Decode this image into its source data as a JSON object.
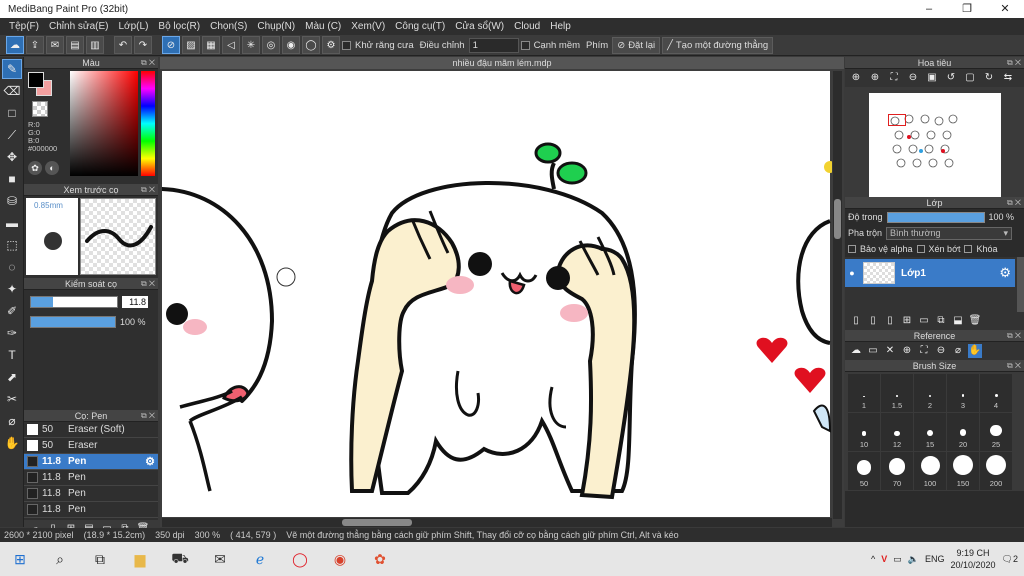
{
  "window": {
    "title": "MediBang Paint Pro (32bit)",
    "buttons": [
      "–",
      "❐",
      "✕"
    ]
  },
  "menu": [
    "Tệp(F)",
    "Chỉnh sửa(E)",
    "Lớp(L)",
    "Bộ lọc(R)",
    "Chọn(S)",
    "Chụp(N)",
    "Màu (C)",
    "Xem(V)",
    "Công cụ(T)",
    "Cửa sổ(W)",
    "Cloud",
    "Help"
  ],
  "toolbar": {
    "antialias_label": "Khử răng cưa",
    "adjust_label": "Điều chỉnh",
    "adjust_value": "1",
    "edge_label": "Cạnh mềm",
    "key_label": "Phím",
    "reset_label": "Đặt lại",
    "line_label": "Tạo một đường thẳng"
  },
  "panels": {
    "color": {
      "title": "Màu",
      "r": "R:0",
      "g": "G:0",
      "b": "B:0",
      "hex": "#000000",
      "fg": "#000000",
      "bg": "#f3a0a0"
    },
    "preview": {
      "title": "Xem trước cọ",
      "size": "0.85mm"
    },
    "control": {
      "title": "Kiểm soát cọ",
      "size_value": "11.8",
      "size_fraction": 0.25,
      "opacity_value": "100 %",
      "opacity_fraction": 1.0
    },
    "brush": {
      "title": "Cọ: Pen",
      "items": [
        {
          "size": "50",
          "name": "Eraser (Soft)",
          "box": "white",
          "active": false
        },
        {
          "size": "50",
          "name": "Eraser",
          "box": "white",
          "active": false
        },
        {
          "size": "11.8",
          "name": "Pen",
          "box": "dark",
          "active": true
        },
        {
          "size": "11.8",
          "name": "Pen",
          "box": "dark",
          "active": false
        },
        {
          "size": "11.8",
          "name": "Pen",
          "box": "dark",
          "active": false
        },
        {
          "size": "11.8",
          "name": "Pen",
          "box": "dark",
          "active": false
        }
      ]
    },
    "navigator": {
      "title": "Hoa tiêu"
    },
    "layer": {
      "title": "Lớp",
      "opacity_label": "Độ trong",
      "opacity_value": "100 %",
      "blend_label": "Pha trộn",
      "blend_value": "Bình thường",
      "protect_alpha": "Bảo vệ alpha",
      "clip": "Xén bớt",
      "lock": "Khóa",
      "layer_name": "Lớp1"
    },
    "reference": {
      "title": "Reference"
    },
    "brush_size": {
      "title": "Brush Size",
      "sizes": [
        "1",
        "1.5",
        "2",
        "3",
        "4",
        "10",
        "12",
        "15",
        "20",
        "25",
        "50",
        "70",
        "100",
        "150",
        "200"
      ]
    }
  },
  "document": {
    "tab": "nhiều đậu mãm lém.mdp"
  },
  "status": {
    "dimensions": "2600 * 2100 pixel",
    "physical": "(18.9 * 15.2cm)",
    "dpi": "350 dpi",
    "zoom": "300 %",
    "coords": "( 414, 579 )",
    "hint": "Vẽ một đường thẳng bằng cách giữ phím Shift, Thay đổi cỡ cọ bằng cách giữ phím Ctrl, Alt và kéo"
  },
  "taskbar": {
    "language": "ENG",
    "time": "9:19 CH",
    "date": "20/10/2020",
    "notifications": "2"
  }
}
